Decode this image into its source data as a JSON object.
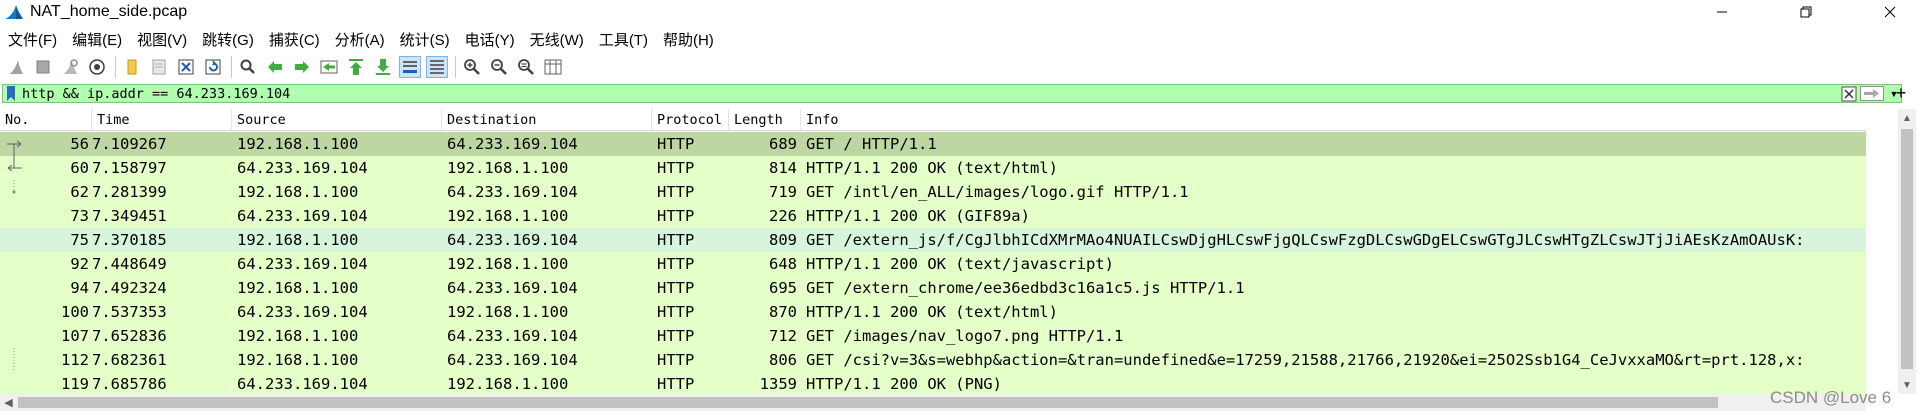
{
  "window": {
    "title": "NAT_home_side.pcap",
    "icon": "wireshark-fin-icon",
    "controls": [
      "minimize",
      "maximize",
      "close"
    ]
  },
  "menu": [
    "文件(F)",
    "编辑(E)",
    "视图(V)",
    "跳转(G)",
    "捕获(C)",
    "分析(A)",
    "统计(S)",
    "电话(Y)",
    "无线(W)",
    "工具(T)",
    "帮助(H)"
  ],
  "toolbar_icons": [
    "start-capture-icon",
    "stop-capture-icon",
    "restart-capture-icon",
    "capture-options-icon",
    "open-file-icon",
    "save-file-icon",
    "close-file-icon",
    "reload-file-icon",
    "find-packet-icon",
    "go-back-icon",
    "go-forward-icon",
    "go-to-packet-icon",
    "go-first-icon",
    "go-last-icon",
    "autoscroll-icon",
    "colorize-icon",
    "zoom-in-icon",
    "zoom-out-icon",
    "zoom-normal-icon",
    "resize-columns-icon"
  ],
  "filter": {
    "value": "http && ip.addr == 64.233.169.104",
    "add_label": "+"
  },
  "columns": [
    "No.",
    "Time",
    "Source",
    "Destination",
    "Protocol",
    "Length",
    "Info"
  ],
  "packets": [
    {
      "no": "56",
      "time": "7.109267",
      "src": "192.168.1.100",
      "dst": "64.233.169.104",
      "proto": "HTTP",
      "len": "689",
      "info": "GET / HTTP/1.1",
      "state": "selected"
    },
    {
      "no": "60",
      "time": "7.158797",
      "src": "64.233.169.104",
      "dst": "192.168.1.100",
      "proto": "HTTP",
      "len": "814",
      "info": "HTTP/1.1 200 OK  (text/html)",
      "state": ""
    },
    {
      "no": "62",
      "time": "7.281399",
      "src": "192.168.1.100",
      "dst": "64.233.169.104",
      "proto": "HTTP",
      "len": "719",
      "info": "GET /intl/en_ALL/images/logo.gif HTTP/1.1",
      "state": ""
    },
    {
      "no": "73",
      "time": "7.349451",
      "src": "64.233.169.104",
      "dst": "192.168.1.100",
      "proto": "HTTP",
      "len": "226",
      "info": "HTTP/1.1 200 OK  (GIF89a)",
      "state": ""
    },
    {
      "no": "75",
      "time": "7.370185",
      "src": "192.168.1.100",
      "dst": "64.233.169.104",
      "proto": "HTTP",
      "len": "809",
      "info": "GET /extern_js/f/CgJlbhICdXMrMAo4NUAILCswDjgHLCswFjgQLCswFzgDLCswGDgELCswGTgJLCswHTgZLCswJTjJiAEsKzAmOAUsK:",
      "state": "hover"
    },
    {
      "no": "92",
      "time": "7.448649",
      "src": "64.233.169.104",
      "dst": "192.168.1.100",
      "proto": "HTTP",
      "len": "648",
      "info": "HTTP/1.1 200 OK  (text/javascript)",
      "state": ""
    },
    {
      "no": "94",
      "time": "7.492324",
      "src": "192.168.1.100",
      "dst": "64.233.169.104",
      "proto": "HTTP",
      "len": "695",
      "info": "GET /extern_chrome/ee36edbd3c16a1c5.js HTTP/1.1",
      "state": ""
    },
    {
      "no": "100",
      "time": "7.537353",
      "src": "64.233.169.104",
      "dst": "192.168.1.100",
      "proto": "HTTP",
      "len": "870",
      "info": "HTTP/1.1 200 OK  (text/html)",
      "state": ""
    },
    {
      "no": "107",
      "time": "7.652836",
      "src": "192.168.1.100",
      "dst": "64.233.169.104",
      "proto": "HTTP",
      "len": "712",
      "info": "GET /images/nav_logo7.png HTTP/1.1",
      "state": ""
    },
    {
      "no": "112",
      "time": "7.682361",
      "src": "192.168.1.100",
      "dst": "64.233.169.104",
      "proto": "HTTP",
      "len": "806",
      "info": "GET /csi?v=3&s=webhp&action=&tran=undefined&e=17259,21588,21766,21920&ei=25O2Ssb1G4_CeJvxxaMO&rt=prt.128,x:",
      "state": ""
    },
    {
      "no": "119",
      "time": "7.685786",
      "src": "64.233.169.104",
      "dst": "192.168.1.100",
      "proto": "HTTP",
      "len": "1359",
      "info": "HTTP/1.1 200 OK  (PNG)",
      "state": ""
    }
  ],
  "watermark": "CSDN @Love 6",
  "colors": {
    "row_bg": "#e4ffc7",
    "row_selected": "#bdd6a2",
    "filter_valid": "#afffaf"
  }
}
